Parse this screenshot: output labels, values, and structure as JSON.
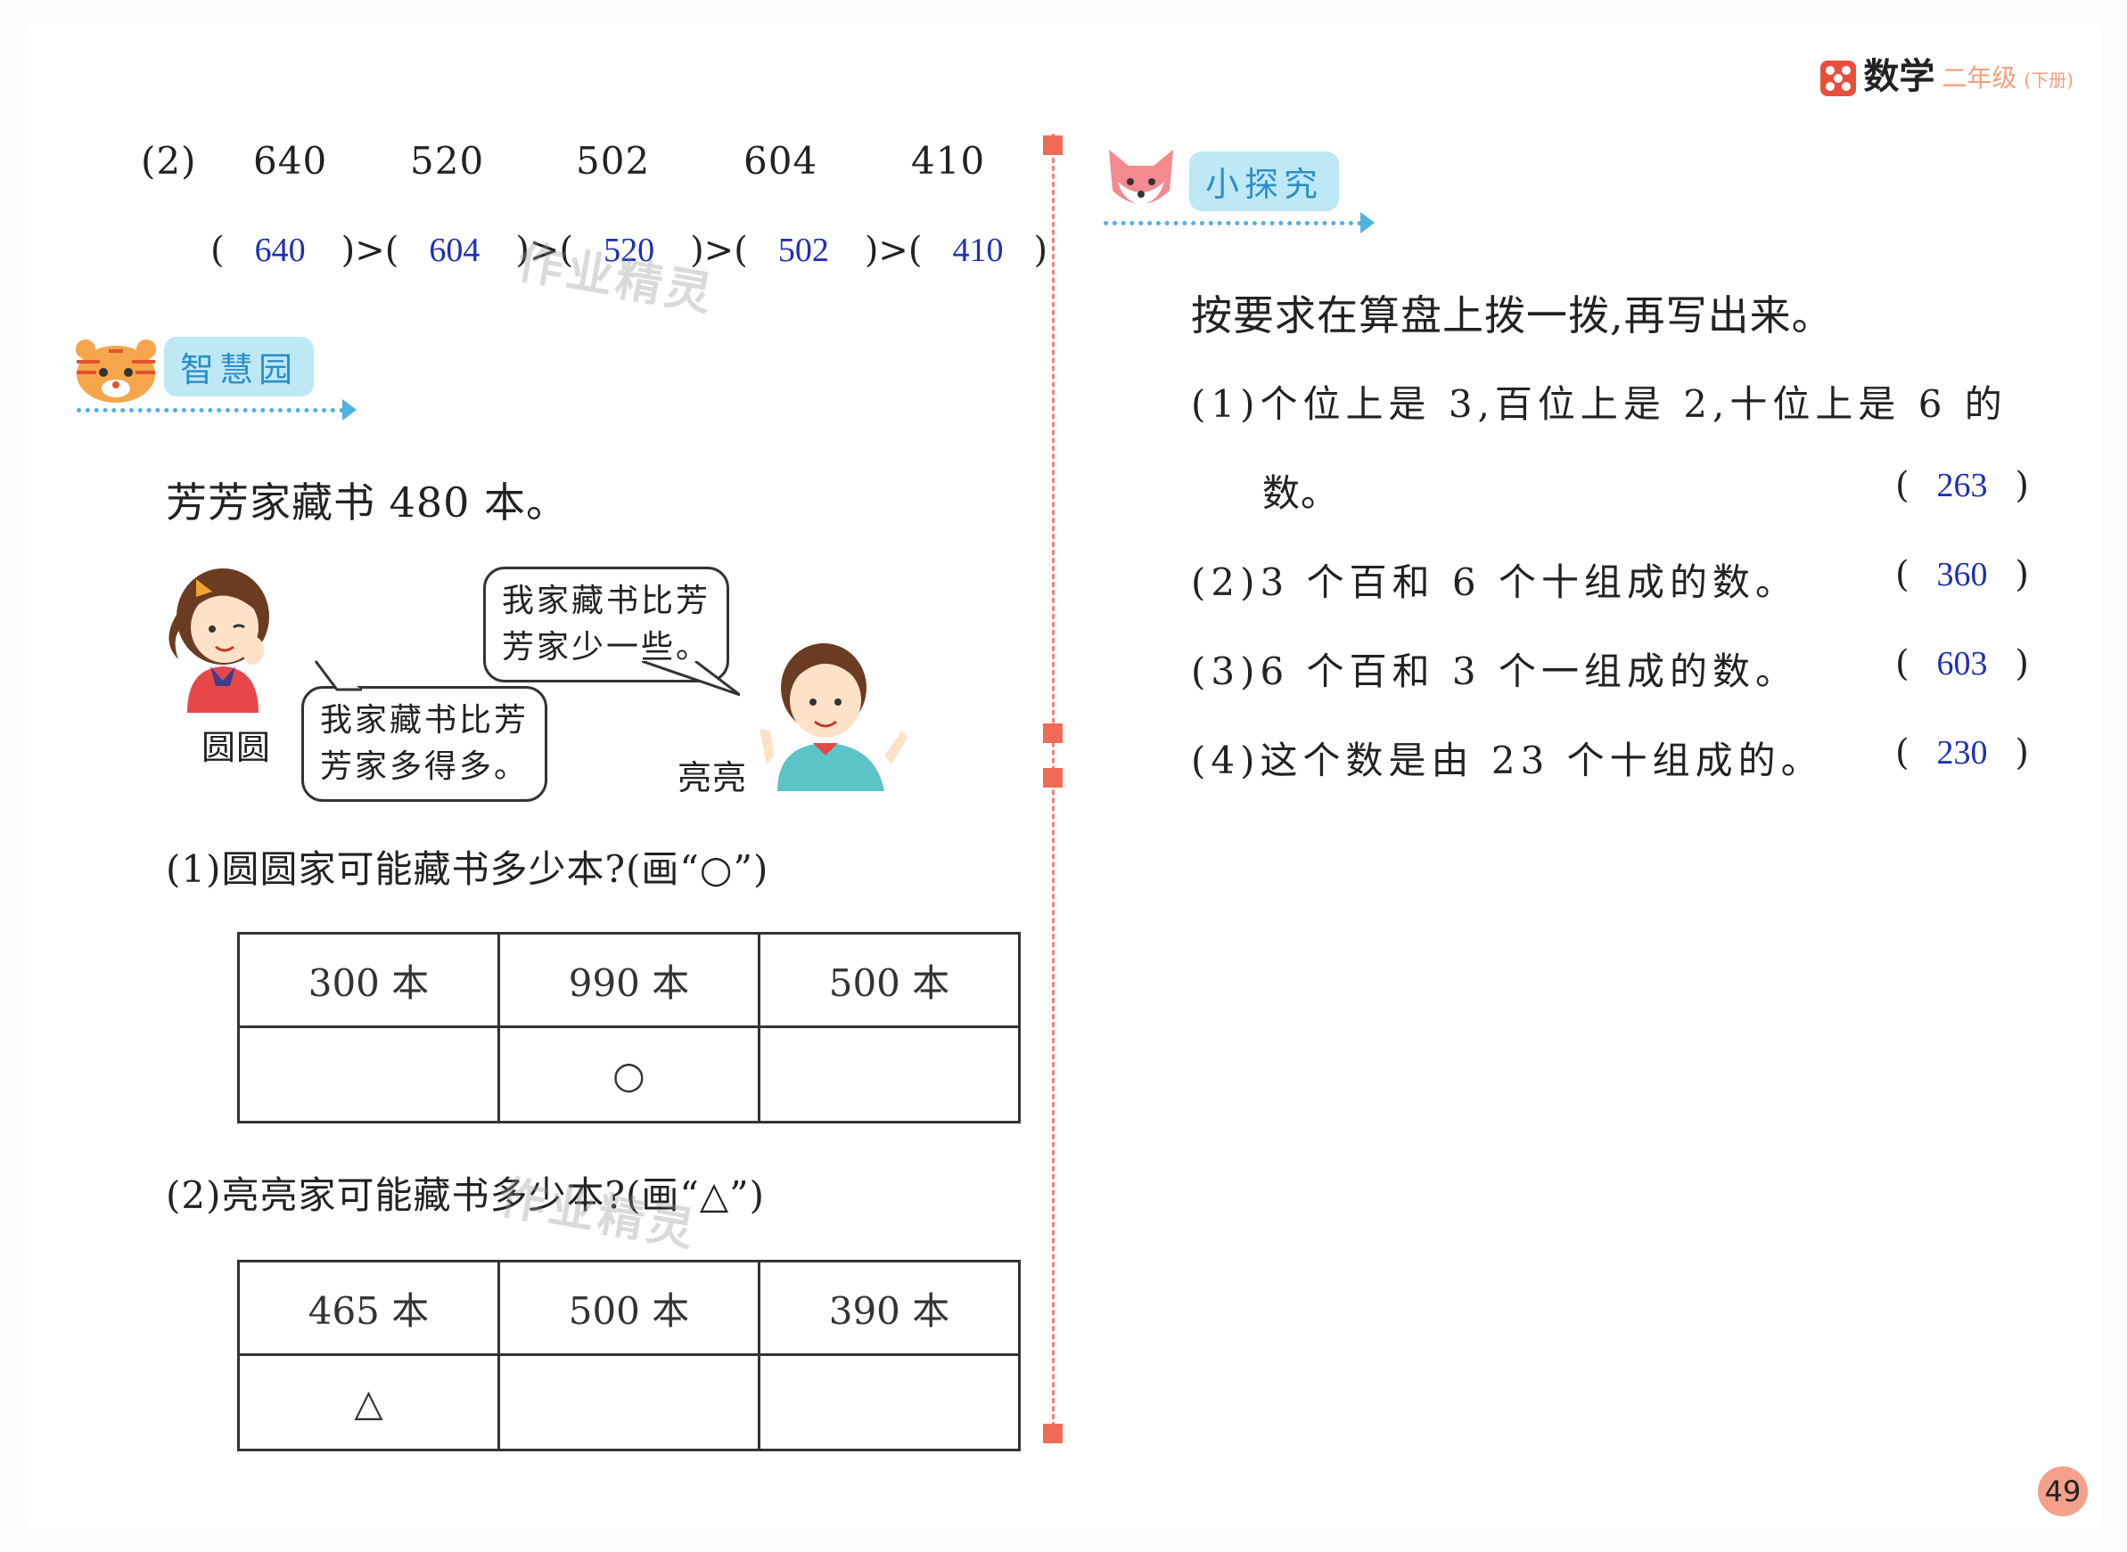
{
  "header": {
    "subject": "数学",
    "grade": "二年级",
    "volume": "(下册)"
  },
  "page_number": "49",
  "watermark": "作业精灵",
  "left": {
    "q2_label": "(2)",
    "q2_numbers": [
      "640",
      "520",
      "502",
      "604",
      "410"
    ],
    "q2_answers": [
      "640",
      "604",
      "520",
      "502",
      "410"
    ],
    "gt": ")>(",
    "open_paren": "(",
    "close_paren": ")",
    "section_title": "智慧园",
    "intro": "芳芳家藏书 480 本。",
    "bubble_top": [
      "我家藏书比芳",
      "芳家少一些。"
    ],
    "bubble_bottom": [
      "我家藏书比芳",
      "芳家多得多。"
    ],
    "girl_name": "圆圆",
    "boy_name": "亮亮",
    "sub1": "(1)圆圆家可能藏书多少本?(画“○”)",
    "table1_headers": [
      "300 本",
      "990 本",
      "500 本"
    ],
    "table1_marks": [
      "",
      "○",
      ""
    ],
    "sub2": "(2)亮亮家可能藏书多少本?(画“△”)",
    "table2_headers": [
      "465 本",
      "500 本",
      "390 本"
    ],
    "table2_marks": [
      "△",
      "",
      ""
    ]
  },
  "right": {
    "section_title": "小探究",
    "intro": "按要求在算盘上拨一拨,再写出来。",
    "q1_line1": "(1)个位上是 3,百位上是 2,十位上是 6 的",
    "q1_line2": "数。",
    "q1_answer": "263",
    "q2": "(2)3 个百和 6 个十组成的数。",
    "q2_answer": "360",
    "q3": "(3)6 个百和 3 个一组成的数。",
    "q3_answer": "603",
    "q4": "(4)这个数是由 23 个十组成的。",
    "q4_answer": "230"
  },
  "colors": {
    "answer": "#1f2fb5",
    "accent": "#ef6b55",
    "badge_bg": "#bfe8f7",
    "badge_text": "#2a8fc7"
  }
}
